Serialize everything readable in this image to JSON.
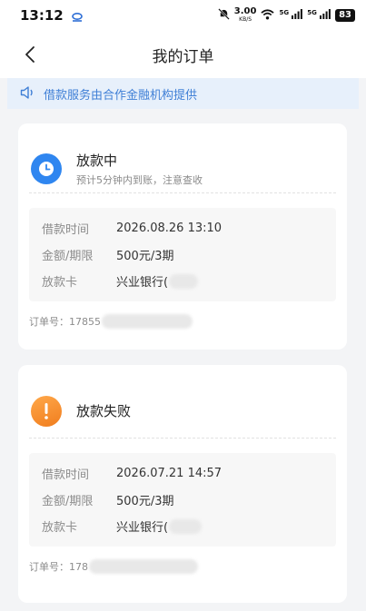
{
  "status_bar": {
    "time": "13:12",
    "speed_value": "3.00",
    "speed_unit": "KB/S",
    "sig1": "5G",
    "sig2": "5G",
    "battery": "83"
  },
  "nav": {
    "title": "我的订单"
  },
  "notice": {
    "text": "借款服务由合作金融机构提供"
  },
  "orders": [
    {
      "status": "放款中",
      "subtitle": "预计5分钟内到账，注意查收",
      "icon": "clock-icon",
      "time_label": "借款时间",
      "time_value": "2026.08.26 13:10",
      "amount_label": "金额/期限",
      "amount_value": "500元/3期",
      "card_label": "放款卡",
      "card_value": "兴业银行(",
      "order_prefix": "订单号：17855"
    },
    {
      "status": "放款失败",
      "subtitle": "",
      "icon": "exclamation-icon",
      "time_label": "借款时间",
      "time_value": "2026.07.21 14:57",
      "amount_label": "金额/期限",
      "amount_value": "500元/3期",
      "card_label": "放款卡",
      "card_value": "兴业银行(",
      "order_prefix": "订单号：178"
    }
  ],
  "colors": {
    "accent_blue": "#2f86f0",
    "accent_orange": "#f5922f",
    "notice_bg": "#e7f0fb"
  }
}
